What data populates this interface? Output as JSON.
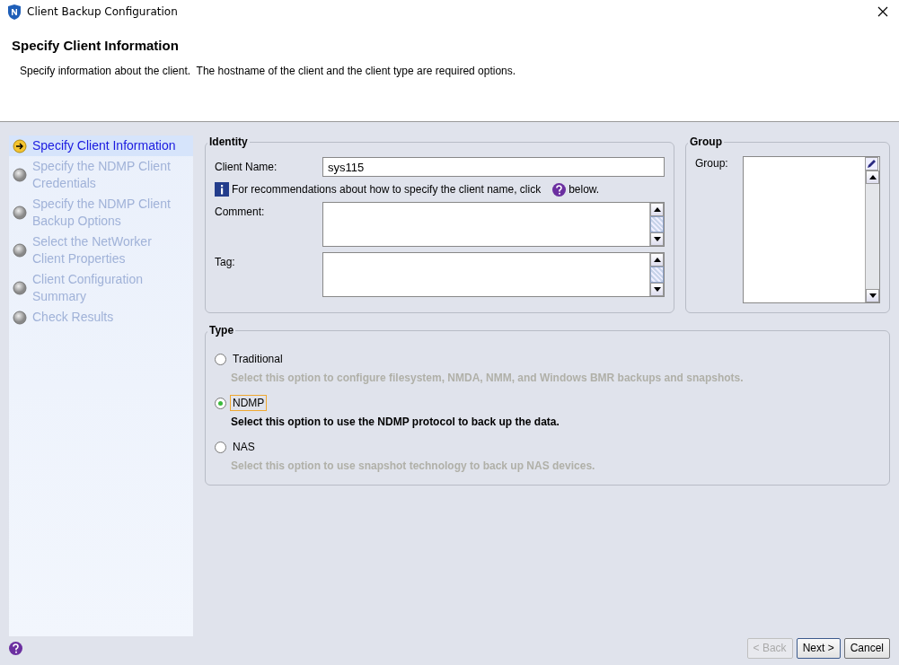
{
  "window": {
    "title": "Client Backup Configuration"
  },
  "header": {
    "title": "Specify Client Information",
    "description": "Specify information about the client.  The hostname of the client and the client type are required options."
  },
  "steps": [
    {
      "label": "Specify Client Information",
      "selected": true
    },
    {
      "label": "Specify the NDMP Client Credentials",
      "selected": false
    },
    {
      "label": "Specify the NDMP Client Backup Options",
      "selected": false
    },
    {
      "label": "Select the NetWorker Client Properties",
      "selected": false
    },
    {
      "label": "Client Configuration Summary",
      "selected": false
    },
    {
      "label": "Check Results",
      "selected": false
    }
  ],
  "identity": {
    "legend": "Identity",
    "client_name_label": "Client Name:",
    "client_name_value": "sys115",
    "hint_text": "For recommendations about how to specify the client name, click",
    "hint_suffix": "below.",
    "comment_label": "Comment:",
    "tag_label": "Tag:"
  },
  "group": {
    "legend": "Group",
    "label": "Group:"
  },
  "type": {
    "legend": "Type",
    "options": [
      {
        "label": "Traditional",
        "description": "Select this option to configure filesystem, NMDA, NMM, and Windows BMR backups and snapshots.",
        "selected": false
      },
      {
        "label": "NDMP",
        "description": "Select this option to use the NDMP protocol to back up the data.",
        "selected": true
      },
      {
        "label": "NAS",
        "description": "Select this option to use snapshot technology to back up NAS devices.",
        "selected": false
      }
    ]
  },
  "buttons": [
    {
      "label": "< Back",
      "disabled": true
    },
    {
      "label": "Next >",
      "disabled": false
    },
    {
      "label": "Cancel",
      "disabled": false
    }
  ]
}
